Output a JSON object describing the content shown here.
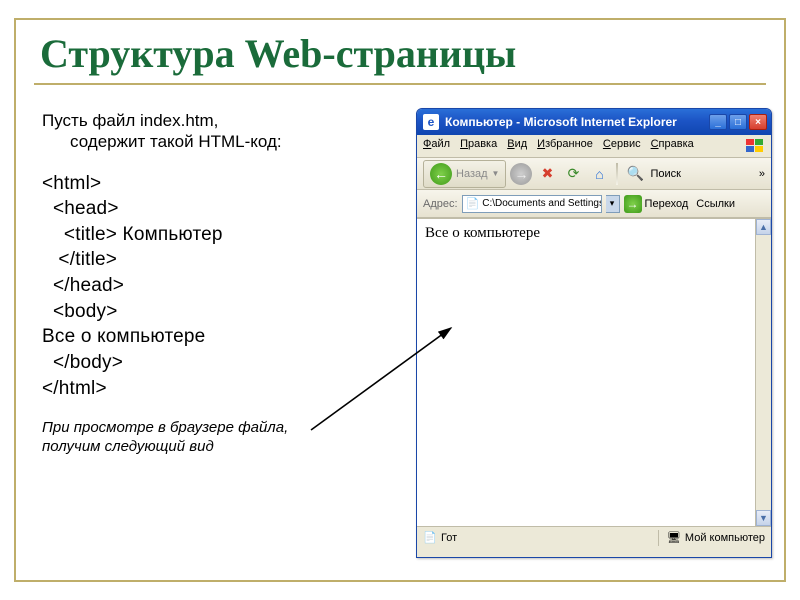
{
  "title": "Структура Web-страницы",
  "intro_line1": "Пусть  файл index.htm,",
  "intro_line2": "содержит такой HTML-код:",
  "code": {
    "l1": "<html>",
    "l2": "  <head>",
    "l3": "    <title> Компьютер",
    "l4": "   </title>",
    "l5": "  </head>",
    "l6": "  <body>",
    "l7": "Все о компьютере",
    "l8": "  </body>",
    "l9": "</html>"
  },
  "outro_line1": "При просмотре в браузере файла,",
  "outro_line2": "получим следующий вид",
  "ie": {
    "title": "Компьютер - Microsoft Internet Explorer",
    "menu": [
      "Файл",
      "Правка",
      "Вид",
      "Избранное",
      "Сервис",
      "Справка"
    ],
    "back_label": "Назад",
    "search_label": "Поиск",
    "address_label": "Адрес:",
    "address_value": "C:\\Documents and Settings\\",
    "go_label": "Переход",
    "links_label": "Ссылки",
    "content_text": "Все о компьютере",
    "status_left": "Гот",
    "status_right": "Мой компьютер",
    "chevron": "»"
  }
}
